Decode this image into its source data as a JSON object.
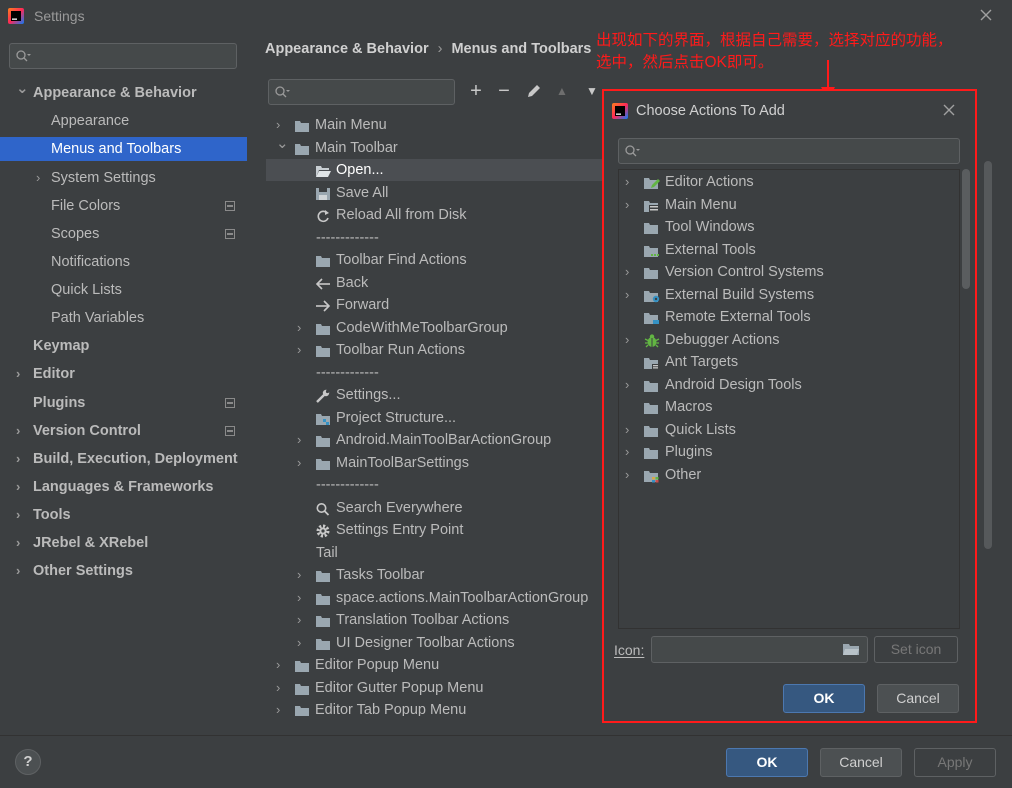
{
  "window": {
    "title": "Settings"
  },
  "left_nav": {
    "search_placeholder": "",
    "items": [
      {
        "label": "Appearance & Behavior",
        "bold": true,
        "chevron": "expanded"
      },
      {
        "label": "Appearance"
      },
      {
        "label": "Menus and Toolbars",
        "selected": true
      },
      {
        "label": "System Settings",
        "chevron": "collapsed"
      },
      {
        "label": "File Colors",
        "project_icon": true
      },
      {
        "label": "Scopes",
        "project_icon": true
      },
      {
        "label": "Notifications"
      },
      {
        "label": "Quick Lists"
      },
      {
        "label": "Path Variables"
      },
      {
        "label": "Keymap",
        "bold": true
      },
      {
        "label": "Editor",
        "bold": true,
        "chevron": "collapsed"
      },
      {
        "label": "Plugins",
        "bold": true,
        "project_icon": true
      },
      {
        "label": "Version Control",
        "bold": true,
        "chevron": "collapsed",
        "project_icon": true
      },
      {
        "label": "Build, Execution, Deployment",
        "bold": true,
        "chevron": "collapsed"
      },
      {
        "label": "Languages & Frameworks",
        "bold": true,
        "chevron": "collapsed"
      },
      {
        "label": "Tools",
        "bold": true,
        "chevron": "collapsed"
      },
      {
        "label": "JRebel & XRebel",
        "bold": true,
        "chevron": "collapsed"
      },
      {
        "label": "Other Settings",
        "bold": true,
        "chevron": "collapsed"
      }
    ]
  },
  "breadcrumb": {
    "parent": "Appearance & Behavior",
    "separator": "›",
    "current": "Menus and Toolbars"
  },
  "toolbar": {
    "add": "+",
    "remove": "−",
    "edit": "edit",
    "up": "▲",
    "down": "▼"
  },
  "tree": {
    "items": [
      {
        "label": "Main Menu",
        "chevron": "collapsed",
        "icon": "folder-icon",
        "level": 0
      },
      {
        "label": "Main Toolbar",
        "chevron": "expanded",
        "icon": "folder-icon",
        "level": 0
      },
      {
        "label": "Open...",
        "icon": "open-folder-icon",
        "level": 1,
        "selected": true
      },
      {
        "label": "Save All",
        "icon": "save-icon",
        "level": 1
      },
      {
        "label": "Reload All from Disk",
        "icon": "reload-icon",
        "level": 1
      },
      {
        "label": "-------------",
        "level": 1
      },
      {
        "label": "Toolbar Find Actions",
        "icon": "folder-icon",
        "level": 1
      },
      {
        "label": "Back",
        "icon": "arrow-left-icon",
        "level": 1
      },
      {
        "label": "Forward",
        "icon": "arrow-right-icon",
        "level": 1
      },
      {
        "label": "CodeWithMeToolbarGroup",
        "chevron": "collapsed",
        "icon": "folder-icon",
        "level": 1
      },
      {
        "label": "Toolbar Run Actions",
        "chevron": "collapsed",
        "icon": "folder-icon",
        "level": 1
      },
      {
        "label": "-------------",
        "level": 1
      },
      {
        "label": "Settings...",
        "icon": "wrench-icon",
        "level": 1
      },
      {
        "label": "Project Structure...",
        "icon": "project-structure-icon",
        "level": 1
      },
      {
        "label": "Android.MainToolBarActionGroup",
        "chevron": "collapsed",
        "icon": "folder-icon",
        "level": 1
      },
      {
        "label": "MainToolBarSettings",
        "chevron": "collapsed",
        "icon": "folder-icon",
        "level": 1
      },
      {
        "label": "-------------",
        "level": 1
      },
      {
        "label": "Search Everywhere",
        "icon": "search-icon",
        "level": 1
      },
      {
        "label": "Settings Entry Point",
        "icon": "gear-icon",
        "level": 1
      },
      {
        "label": "Tail",
        "level": 1
      },
      {
        "label": "Tasks Toolbar",
        "chevron": "collapsed",
        "icon": "folder-icon",
        "level": 1
      },
      {
        "label": "space.actions.MainToolbarActionGroup",
        "chevron": "collapsed",
        "icon": "folder-icon",
        "level": 1
      },
      {
        "label": "Translation Toolbar Actions",
        "chevron": "collapsed",
        "icon": "folder-icon",
        "level": 1
      },
      {
        "label": "UI Designer Toolbar Actions",
        "chevron": "collapsed",
        "icon": "folder-icon",
        "level": 1
      },
      {
        "label": "Editor Popup Menu",
        "chevron": "collapsed",
        "icon": "folder-icon",
        "level": 0
      },
      {
        "label": "Editor Gutter Popup Menu",
        "chevron": "collapsed",
        "icon": "folder-icon",
        "level": 0
      },
      {
        "label": "Editor Tab Popup Menu",
        "chevron": "collapsed",
        "icon": "folder-icon",
        "level": 0
      }
    ]
  },
  "dialog": {
    "title": "Choose Actions To Add",
    "search_placeholder": "",
    "items": [
      {
        "label": "Editor Actions",
        "chevron": true,
        "icon": "editor-actions-icon"
      },
      {
        "label": "Main Menu",
        "chevron": true,
        "icon": "main-menu-icon"
      },
      {
        "label": "Tool Windows",
        "chevron": false,
        "icon": "folder-icon"
      },
      {
        "label": "External Tools",
        "chevron": false,
        "icon": "external-tools-icon"
      },
      {
        "label": "Version Control Systems",
        "chevron": true,
        "icon": "folder-icon"
      },
      {
        "label": "External Build Systems",
        "chevron": true,
        "icon": "build-systems-icon"
      },
      {
        "label": "Remote External Tools",
        "chevron": false,
        "icon": "remote-tools-icon"
      },
      {
        "label": "Debugger Actions",
        "chevron": true,
        "icon": "bug-icon"
      },
      {
        "label": "Ant Targets",
        "chevron": false,
        "icon": "ant-targets-icon"
      },
      {
        "label": "Android Design Tools",
        "chevron": true,
        "icon": "folder-icon"
      },
      {
        "label": "Macros",
        "chevron": false,
        "icon": "folder-icon"
      },
      {
        "label": "Quick Lists",
        "chevron": true,
        "icon": "folder-icon"
      },
      {
        "label": "Plugins",
        "chevron": true,
        "icon": "folder-icon"
      },
      {
        "label": "Other",
        "chevron": true,
        "icon": "other-icon"
      }
    ],
    "icon_label": "Icon:",
    "icon_value": "",
    "set_icon_label": "Set icon",
    "ok_label": "OK",
    "cancel_label": "Cancel"
  },
  "annotation": {
    "line1": "出现如下的界面，根据自己需要，选择对应的功能，",
    "line2": "选中，然后点击OK即可。",
    "color": "#ff1a1a"
  },
  "bottom": {
    "help_label": "?",
    "ok_label": "OK",
    "cancel_label": "Cancel",
    "apply_label": "Apply"
  },
  "colors": {
    "background": "#3c3f41",
    "selection": "#2f65ca",
    "primary_button": "#365880",
    "annotation": "#ff1a1a"
  }
}
